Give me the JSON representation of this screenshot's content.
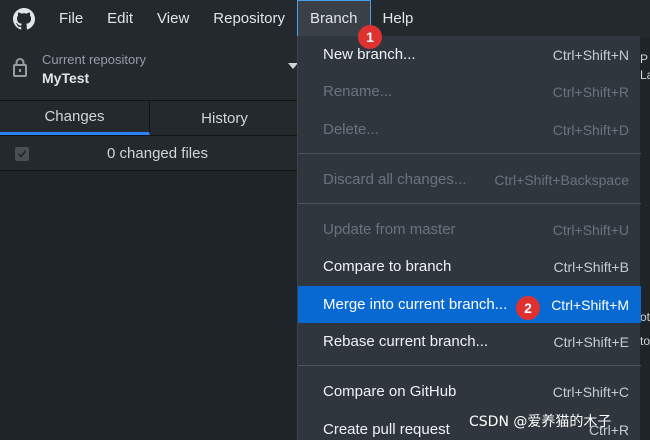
{
  "menubar": {
    "items": [
      "File",
      "Edit",
      "View",
      "Repository",
      "Branch",
      "Help"
    ],
    "active": "Branch"
  },
  "repo": {
    "caption": "Current repository",
    "name": "MyTest"
  },
  "tabs": [
    "Changes",
    "History"
  ],
  "changes": {
    "summary": "0 changed files"
  },
  "branch_menu": {
    "items": [
      {
        "label": "New branch...",
        "shortcut": "Ctrl+Shift+N",
        "state": "enabled"
      },
      {
        "label": "Rename...",
        "shortcut": "Ctrl+Shift+R",
        "state": "disabled"
      },
      {
        "label": "Delete...",
        "shortcut": "Ctrl+Shift+D",
        "state": "disabled"
      },
      {
        "label": "Discard all changes...",
        "shortcut": "Ctrl+Shift+Backspace",
        "state": "disabled"
      },
      {
        "label": "Update from master",
        "shortcut": "Ctrl+Shift+U",
        "state": "disabled"
      },
      {
        "label": "Compare to branch",
        "shortcut": "Ctrl+Shift+B",
        "state": "enabled"
      },
      {
        "label": "Merge into current branch...",
        "shortcut": "Ctrl+Shift+M",
        "state": "highlighted"
      },
      {
        "label": "Rebase current branch...",
        "shortcut": "Ctrl+Shift+E",
        "state": "enabled"
      },
      {
        "label": "Compare on GitHub",
        "shortcut": "Ctrl+Shift+C",
        "state": "enabled"
      },
      {
        "label": "Create pull request",
        "shortcut": "Ctrl+R",
        "state": "enabled"
      }
    ]
  },
  "annotations": [
    "1",
    "2"
  ],
  "peek": {
    "a": "P",
    "b": "La",
    "c": "ot",
    "d": "to"
  },
  "watermark": "CSDN @爱养猫的木子",
  "colors": {
    "background": "#24292e",
    "menu_bg": "#2f363d",
    "highlight": "#0869d3",
    "badge": "#e03131",
    "tab_underline": "#2f81f7"
  },
  "icons": [
    "github-logo-icon",
    "lock-icon",
    "caret-down-icon",
    "checkbox-icon"
  ]
}
